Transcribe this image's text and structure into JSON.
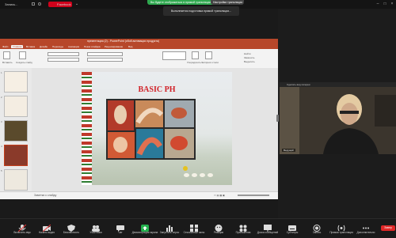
{
  "top": {
    "item1": "Запись...",
    "item2": "Facebook",
    "notice": "Вы будете отображаться в прямой трансляции. Нажмите...",
    "stream_status": "Настройки трансляции",
    "toast": "Выполняется подготовка прямой трансляции..."
  },
  "ppt": {
    "title": "презентация (2) - PowerPoint (сбой активации продукта)",
    "tabs": [
      "Файл",
      "Главная",
      "Вставка",
      "Дизайн",
      "Переходы",
      "Анимация",
      "Показ слайдов",
      "Рецензирование",
      "Вид"
    ],
    "ribbon": {
      "paste": "Вставить",
      "create": "Создать слайд",
      "arrange": "Упорядочить",
      "styles": "Экспресс-стили",
      "find": "Найти",
      "replace": "Заменить",
      "select": "Выделить"
    },
    "slide_numbers": [
      "1",
      "2",
      "3",
      "4",
      "5"
    ],
    "notes_placeholder": "Заметки к слайду",
    "slide_title": "BASIC PH"
  },
  "video": {
    "top_label": "Сделать вид галереи",
    "participant": "Ведущий"
  },
  "toolbar": [
    {
      "label": "Включить звук",
      "icon": "microphone-icon"
    },
    {
      "label": "Начать видео",
      "icon": "video-icon"
    },
    {
      "label": "Безопасность",
      "icon": "shield-icon"
    },
    {
      "label": "Участники",
      "icon": "participants-icon"
    },
    {
      "label": "Чат",
      "icon": "chat-icon"
    },
    {
      "label": "Демонстрация экрана",
      "icon": "share-screen-icon"
    },
    {
      "label": "Запустить опрос",
      "icon": "poll-icon"
    },
    {
      "label": "Сессионные залы",
      "icon": "breakout-icon"
    },
    {
      "label": "Реакции",
      "icon": "reactions-icon"
    },
    {
      "label": "Приложения",
      "icon": "apps-icon"
    },
    {
      "label": "Доска сообщений",
      "icon": "whiteboard-icon"
    },
    {
      "label": "Субтитры",
      "icon": "captions-icon"
    },
    {
      "label": "Запись",
      "icon": "record-icon"
    },
    {
      "label": "Прямая трансляция",
      "icon": "live-icon"
    },
    {
      "label": "Дополнительно",
      "icon": "more-icon"
    }
  ],
  "end_label": "Завер",
  "colors": {
    "ppt_red": "#b7472a",
    "slide_title": "#d11f26",
    "end": "#e02828"
  }
}
